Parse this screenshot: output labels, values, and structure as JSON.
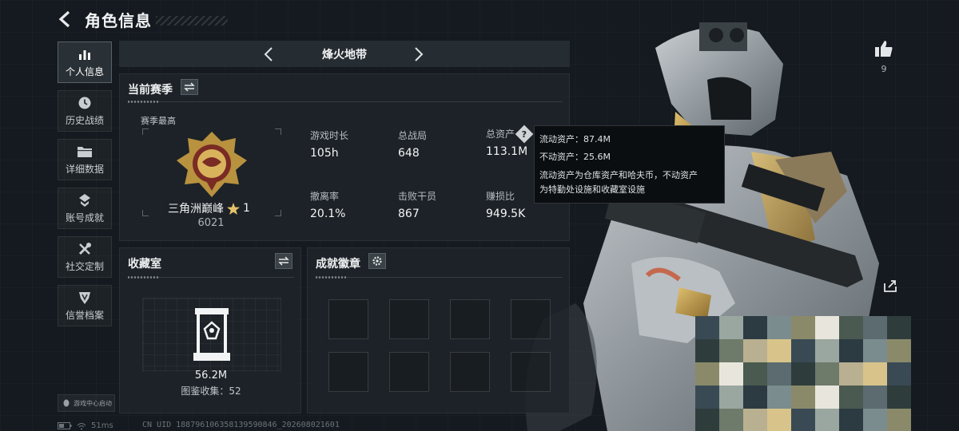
{
  "header": {
    "title": "角色信息"
  },
  "sidebar": {
    "items": [
      {
        "label": "个人信息",
        "icon": "bar-chart-icon",
        "active": true
      },
      {
        "label": "历史战绩",
        "icon": "clock-icon",
        "active": false
      },
      {
        "label": "详细数据",
        "icon": "folder-icon",
        "active": false
      },
      {
        "label": "账号成就",
        "icon": "achievement-icon",
        "active": false
      },
      {
        "label": "社交定制",
        "icon": "tools-icon",
        "active": false
      },
      {
        "label": "信誉档案",
        "icon": "shield-icon",
        "active": false
      }
    ],
    "launch_label": "游戏中心启动"
  },
  "mode": {
    "name": "烽火地带"
  },
  "season": {
    "title": "当前赛季",
    "best_label": "赛季最高",
    "rank_name": "三角洲巅峰",
    "rank_star": "1",
    "rank_points": "6021",
    "stats": [
      {
        "label": "游戏时长",
        "value": "105h"
      },
      {
        "label": "总战局",
        "value": "648"
      },
      {
        "label": "总资产",
        "value": "113.1M",
        "help": true
      },
      {
        "label": "撤离率",
        "value": "20.1%"
      },
      {
        "label": "击败干员",
        "value": "867"
      },
      {
        "label": "赚损比",
        "value": "949.5K"
      }
    ]
  },
  "tooltip": {
    "liquid": "流动资产：87.4M",
    "fixed": "不动资产：25.6M",
    "desc_line1": "流动资产为仓库资产和哈夫币，不动资产",
    "desc_line2": "为特勤处设施和收藏室设施"
  },
  "vault": {
    "title": "收藏室",
    "value": "56.2M",
    "collection": "图鉴收集：52"
  },
  "badges": {
    "title": "成就徽章"
  },
  "likes": {
    "count": "9"
  },
  "status": {
    "ping": "51ms",
    "uid": "CN UID 18879610635813959084​6_202608021601"
  },
  "colors": {
    "accent_gold": "#c8a24a",
    "panel": "#1e252a",
    "background": "#141a1f"
  }
}
